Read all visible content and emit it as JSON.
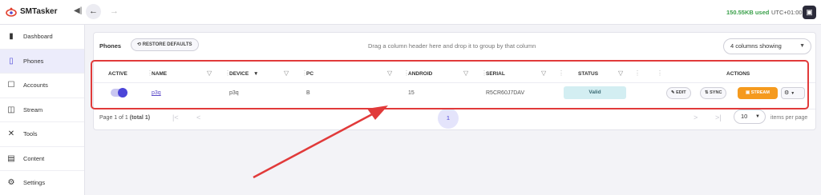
{
  "app": {
    "name": "SMTasker",
    "storage": "150.55KB used",
    "timezone": "UTC+01:00"
  },
  "sidebar": {
    "items": [
      {
        "label": "Dashboard",
        "icon": "bar-chart-icon"
      },
      {
        "label": "Phones",
        "icon": "phone-icon",
        "active": true
      },
      {
        "label": "Accounts",
        "icon": "account-icon"
      },
      {
        "label": "Stream",
        "icon": "stream-icon"
      },
      {
        "label": "Tools",
        "icon": "tools-icon"
      },
      {
        "label": "Content",
        "icon": "content-icon"
      },
      {
        "label": "Settings",
        "icon": "gear-icon"
      }
    ]
  },
  "phones": {
    "title": "Phones",
    "restore_label": "RESTORE DEFAULTS",
    "drag_hint": "Drag a column header here and drop it to group by that column",
    "columns_select": "4 columns showing",
    "headers": {
      "active": "ACTIVE",
      "name": "NAME",
      "device": "DEVICE",
      "pc": "PC",
      "android": "ANDROID",
      "serial": "SERIAL",
      "status": "STATUS",
      "actions": "ACTIONS"
    },
    "row": {
      "active": true,
      "name": "p3q",
      "device": "p3q",
      "pc": "B",
      "android": "15",
      "serial": "R5CR60J7DAV",
      "status": "Valid"
    },
    "actions": {
      "edit": "EDIT",
      "sync": "SYNC",
      "stream": "STREAM"
    },
    "pagination": {
      "info": "Page 1 of 1",
      "total": "(total 1)",
      "current_page": "1",
      "per_page": "10",
      "per_page_label": "items per page"
    }
  },
  "colors": {
    "accent": "#4b45d8",
    "stream": "#f59a1e",
    "status_valid_bg": "#d3eef2",
    "annotation": "#e13a3a",
    "storage": "#3aa04a"
  }
}
